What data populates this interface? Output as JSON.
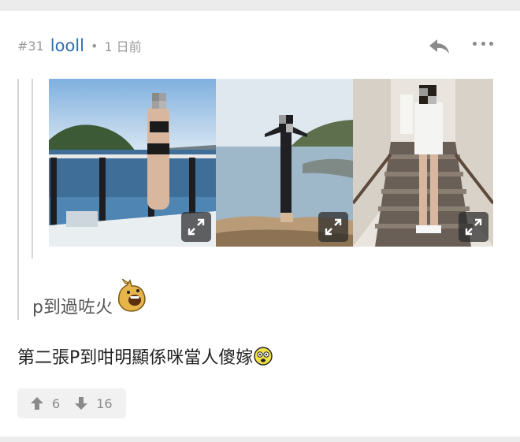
{
  "post": {
    "number": "#31",
    "username": "looll",
    "separator": "•",
    "time": "1 日前"
  },
  "quote": {
    "text": "p到過咗火"
  },
  "comment": {
    "text": "第二張P到咁明顯係咪當人傻嫁"
  },
  "votes": {
    "up": "6",
    "down": "16"
  },
  "icons": {
    "reply": "reply-arrow-icon",
    "more": "more-dots-icon",
    "expand": "expand-icon",
    "upvote": "arrow-up-icon",
    "downvote": "arrow-down-icon",
    "quote_emoji": "laughing-creature-emoji",
    "comment_emoji": "shocked-face-emoji"
  },
  "colors": {
    "username": "#2f6db3",
    "meta": "#9a9a9a",
    "quote_text": "#555555",
    "body_text": "#222222"
  }
}
